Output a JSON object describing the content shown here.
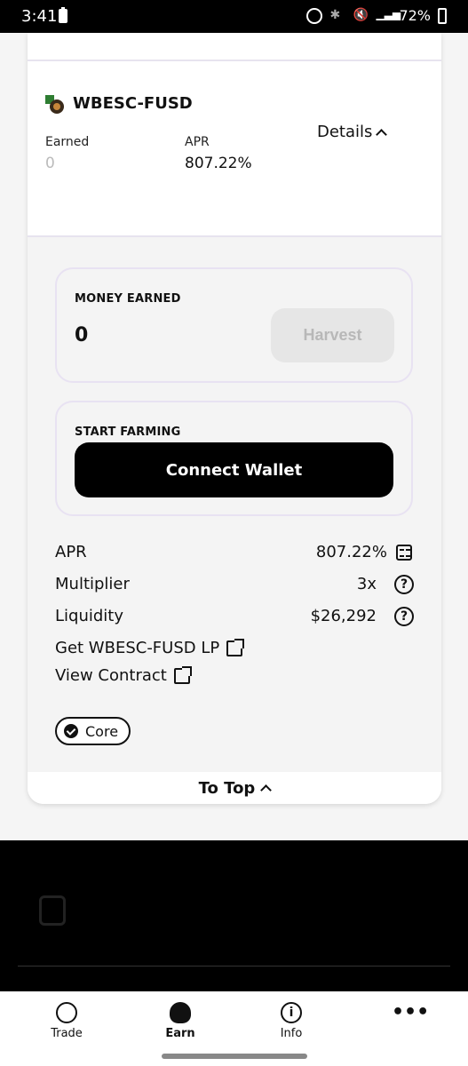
{
  "status_bar": {
    "time": "3:41",
    "battery": "72%"
  },
  "farm": {
    "pair_name": "WBESC-FUSD",
    "earned_label": "Earned",
    "earned_value": "0",
    "apr_label": "APR",
    "apr_value": "807.22%",
    "details_label": "Details"
  },
  "money_earned": {
    "title": "MONEY EARNED",
    "value": "0",
    "harvest_label": "Harvest"
  },
  "start_farming": {
    "title": "START FARMING",
    "connect_label": "Connect Wallet"
  },
  "stats": {
    "apr_label": "APR",
    "apr_value": "807.22%",
    "multiplier_label": "Multiplier",
    "multiplier_value": "3x",
    "liquidity_label": "Liquidity",
    "liquidity_value": "$26,292"
  },
  "links": {
    "get_lp": "Get WBESC-FUSD LP",
    "view_contract": "View Contract"
  },
  "badge": {
    "label": "Core"
  },
  "to_top": {
    "label": "To Top"
  },
  "bottom_nav": [
    {
      "label": "Trade",
      "icon": "trade-icon"
    },
    {
      "label": "Earn",
      "icon": "money-bag-icon"
    },
    {
      "label": "Info",
      "icon": "info-icon"
    },
    {
      "label": "",
      "icon": "more-icon"
    }
  ]
}
